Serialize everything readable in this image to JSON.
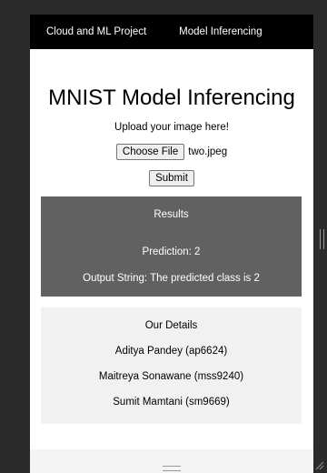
{
  "navbar": {
    "links": [
      "Cloud and ML Project",
      "Model Inferencing"
    ]
  },
  "main": {
    "title": "MNIST Model Inferencing",
    "upload_label": "Upload your image here!",
    "choose_file_label": "Choose File",
    "file_name": "two.jpeg",
    "submit_label": "Submit"
  },
  "results": {
    "title": "Results",
    "prediction": "Prediction: 2",
    "output_string": "Output String: The predicted class is 2"
  },
  "details": {
    "title": "Our Details",
    "members": [
      "Aditya Pandey (ap6624)",
      "Maitreya Sonawane (mss9240)",
      "Sumit Mamtani (sm9669)"
    ]
  },
  "colors": {
    "navbar_bg": "#000000",
    "results_bg": "#616161",
    "details_bg": "#f1f1f1"
  }
}
